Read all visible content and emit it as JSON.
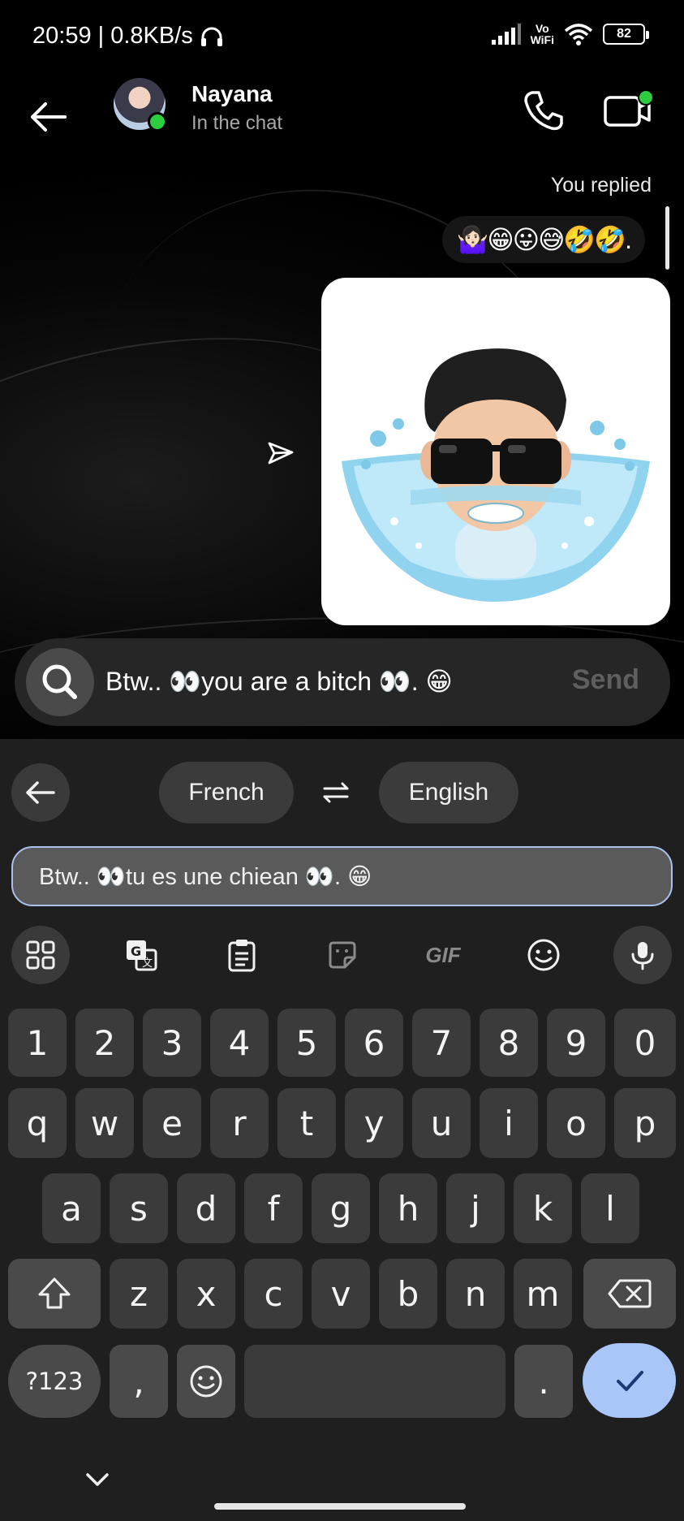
{
  "status_bar": {
    "time": "20:59 | 0.8KB/s",
    "vowifi_top": "Vo",
    "vowifi_bottom": "WiFi",
    "battery": "82"
  },
  "header": {
    "contact_name": "Nayana",
    "contact_status": "In the chat"
  },
  "chat": {
    "replied_label": "You replied",
    "reply_emojis": "🤷🏻‍♀️😁😛😅🤣🤣."
  },
  "composer": {
    "text": "Btw.. 👀you are a bitch 👀. 😁",
    "send_label": "Send"
  },
  "translator": {
    "source_lang": "French",
    "target_lang": "English",
    "translated_text": "Btw.. 👀tu es une chiean 👀. 😁"
  },
  "toolbar": {
    "icons": [
      "apps-grid-icon",
      "translate-icon",
      "clipboard-icon",
      "sticker-icon",
      "gif-icon",
      "emoji-icon",
      "mic-icon"
    ],
    "gif_label": "GIF"
  },
  "keys": {
    "numbers": [
      "1",
      "2",
      "3",
      "4",
      "5",
      "6",
      "7",
      "8",
      "9",
      "0"
    ],
    "row1": [
      "q",
      "w",
      "e",
      "r",
      "t",
      "y",
      "u",
      "i",
      "o",
      "p"
    ],
    "row2": [
      "a",
      "s",
      "d",
      "f",
      "g",
      "h",
      "j",
      "k",
      "l"
    ],
    "row3": [
      "z",
      "x",
      "c",
      "v",
      "b",
      "n",
      "m"
    ],
    "symbols_label": "?123",
    "comma": ",",
    "period": "."
  },
  "colors": {
    "online": "#2ecc40",
    "enter_key": "#a8c6f7",
    "keyboard_bg": "#1f1f1f"
  }
}
